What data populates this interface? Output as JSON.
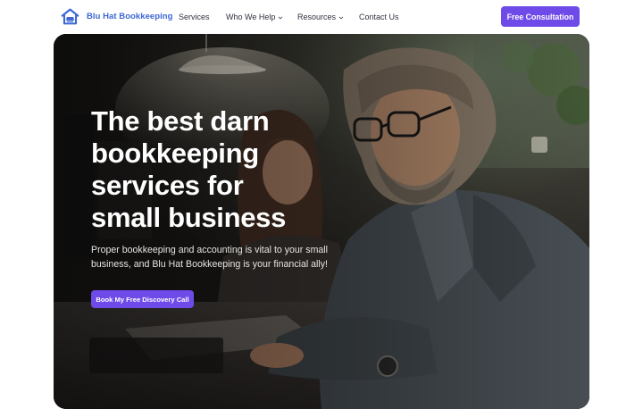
{
  "header": {
    "brand_name": "Blu Hat Bookkeeping",
    "logo_icon": "house-hat-logo-icon",
    "nav": [
      {
        "label": "Services",
        "has_dropdown": false
      },
      {
        "label": "Who We Help",
        "has_dropdown": true
      },
      {
        "label": "Resources",
        "has_dropdown": true
      },
      {
        "label": "Contact Us",
        "has_dropdown": false
      }
    ],
    "cta_label": "Free Consultation"
  },
  "hero": {
    "title_lines": [
      "The best darn",
      "bookkeeping",
      "services for",
      "small business"
    ],
    "subtitle_lines": [
      "Proper bookkeeping and accounting is vital to your small",
      "business, and Blu Hat Bookkeeping is your financial ally!"
    ],
    "cta_label": "Book My Free Discovery Call"
  },
  "colors": {
    "brand_blue": "#3c67d4",
    "accent_purple": "#6e4be8",
    "nav_text": "#2f3140",
    "hero_text": "#ffffff"
  }
}
